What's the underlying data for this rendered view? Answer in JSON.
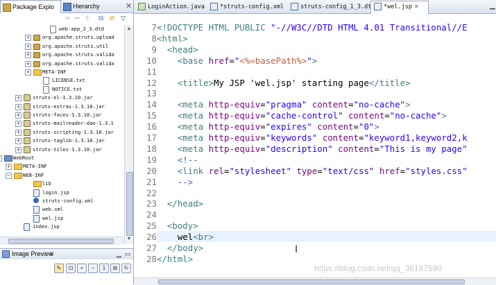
{
  "left_panel": {
    "tab_package_explorer": "Package Explo",
    "tab_hierarchy": "Hierarchy",
    "tree": [
      {
        "label": "web-app_2_3.dtd",
        "icon": "dtd-file-icon",
        "indent": 72,
        "expander": ""
      },
      {
        "label": "org.apache.struts.upload",
        "icon": "package-icon",
        "indent": 48,
        "expander": "+"
      },
      {
        "label": "org.apache.struts.util",
        "icon": "package-icon",
        "indent": 48,
        "expander": "+"
      },
      {
        "label": "org.apache.struts.valida",
        "icon": "package-icon",
        "indent": 48,
        "expander": "+"
      },
      {
        "label": "org.apache.struts.valida",
        "icon": "package-icon",
        "indent": 48,
        "expander": "+"
      },
      {
        "label": "META-INF",
        "icon": "folder-icon",
        "indent": 48,
        "expander": "+"
      },
      {
        "label": "LICENSE.txt",
        "icon": "text-file-icon",
        "indent": 62,
        "expander": ""
      },
      {
        "label": "NOTICE.txt",
        "icon": "text-file-icon",
        "indent": 62,
        "expander": ""
      },
      {
        "label": "struts-el-1.3.10.jar",
        "icon": "jar-icon",
        "indent": 34,
        "expander": "+"
      },
      {
        "label": "struts-extras-1.3.10.jar",
        "icon": "jar-icon",
        "indent": 34,
        "expander": "+"
      },
      {
        "label": "struts-faces-1.3.10.jar",
        "icon": "jar-icon",
        "indent": 34,
        "expander": "+"
      },
      {
        "label": "struts-mailreader-dao-1.3.1",
        "icon": "jar-icon",
        "indent": 34,
        "expander": "+"
      },
      {
        "label": "struts-scripting-1.3.10.jar",
        "icon": "jar-icon",
        "indent": 34,
        "expander": "+"
      },
      {
        "label": "struts-taglib-1.3.10.jar",
        "icon": "jar-icon",
        "indent": 34,
        "expander": "+"
      },
      {
        "label": "struts-tiles-1.3.10.jar",
        "icon": "jar-icon",
        "indent": 34,
        "expander": "+"
      },
      {
        "label": "WebRoot",
        "icon": "webroot-folder-icon",
        "indent": 6,
        "expander": "-"
      },
      {
        "label": "META-INF",
        "icon": "folder-icon",
        "indent": 20,
        "expander": "+"
      },
      {
        "label": "WEB-INF",
        "icon": "folder-icon",
        "indent": 20,
        "expander": "-"
      },
      {
        "label": "lib",
        "icon": "folder-icon",
        "indent": 48,
        "expander": ""
      },
      {
        "label": "login.jsp",
        "icon": "jsp-file-icon",
        "indent": 48,
        "expander": ""
      },
      {
        "label": "struts-config.xml",
        "icon": "gear-icon",
        "indent": 48,
        "expander": ""
      },
      {
        "label": "web.xml",
        "icon": "xml-file-icon",
        "indent": 48,
        "expander": ""
      },
      {
        "label": "wel.jsp",
        "icon": "jsp-file-icon",
        "indent": 48,
        "expander": ""
      },
      {
        "label": "index.jsp",
        "icon": "jsp-file-icon",
        "indent": 34,
        "expander": ""
      }
    ],
    "image_preview_tab": "Image Preview"
  },
  "editor": {
    "tabs": [
      {
        "label": "LoginAction.java",
        "active": false
      },
      {
        "label": "*struts-config.xml",
        "active": false
      },
      {
        "label": "struts-config_1_3.dt",
        "active": false
      },
      {
        "label": "*wel.jsp",
        "active": true
      }
    ],
    "lines": [
      {
        "num": "7",
        "parts": [
          [
            "doct",
            "<!DOCTYPE HTML PUBLIC "
          ],
          [
            "val",
            "\"-//W3C//DTD HTML 4.01 Transitional//E"
          ]
        ]
      },
      {
        "num": "8",
        "parts": [
          [
            "tag",
            "<html>"
          ]
        ]
      },
      {
        "num": "9",
        "parts": [
          [
            "txt",
            "  "
          ],
          [
            "tag",
            "<head>"
          ]
        ]
      },
      {
        "num": "10",
        "parts": [
          [
            "txt",
            "    "
          ],
          [
            "tag",
            "<base "
          ],
          [
            "attr",
            "href"
          ],
          [
            "txt",
            "="
          ],
          [
            "val",
            "\""
          ],
          [
            "jsp",
            "<%=basePath%>"
          ],
          [
            "val",
            "\""
          ],
          [
            "tag",
            ">"
          ]
        ]
      },
      {
        "num": "11",
        "parts": [
          [
            "txt",
            ""
          ]
        ]
      },
      {
        "num": "12",
        "parts": [
          [
            "txt",
            "    "
          ],
          [
            "tag",
            "<title>"
          ],
          [
            "txt",
            "My JSP 'wel.jsp' starting page"
          ],
          [
            "tag",
            "</title>"
          ]
        ]
      },
      {
        "num": "13",
        "parts": [
          [
            "txt",
            ""
          ]
        ]
      },
      {
        "num": "14",
        "parts": [
          [
            "txt",
            "    "
          ],
          [
            "tag",
            "<meta "
          ],
          [
            "attr",
            "http-equiv"
          ],
          [
            "txt",
            "="
          ],
          [
            "val",
            "\"pragma\""
          ],
          [
            "txt",
            " "
          ],
          [
            "attr",
            "content"
          ],
          [
            "txt",
            "="
          ],
          [
            "val",
            "\"no-cache\""
          ],
          [
            "tag",
            ">"
          ]
        ]
      },
      {
        "num": "15",
        "parts": [
          [
            "txt",
            "    "
          ],
          [
            "tag",
            "<meta "
          ],
          [
            "attr",
            "http-equiv"
          ],
          [
            "txt",
            "="
          ],
          [
            "val",
            "\"cache-control\""
          ],
          [
            "txt",
            " "
          ],
          [
            "attr",
            "content"
          ],
          [
            "txt",
            "="
          ],
          [
            "val",
            "\"no-cache\""
          ],
          [
            "tag",
            ">"
          ]
        ]
      },
      {
        "num": "16",
        "parts": [
          [
            "txt",
            "    "
          ],
          [
            "tag",
            "<meta "
          ],
          [
            "attr",
            "http-equiv"
          ],
          [
            "txt",
            "="
          ],
          [
            "val",
            "\"expires\""
          ],
          [
            "txt",
            " "
          ],
          [
            "attr",
            "content"
          ],
          [
            "txt",
            "="
          ],
          [
            "val",
            "\"0\""
          ],
          [
            "tag",
            ">"
          ]
        ]
      },
      {
        "num": "17",
        "parts": [
          [
            "txt",
            "    "
          ],
          [
            "tag",
            "<meta "
          ],
          [
            "attr",
            "http-equiv"
          ],
          [
            "txt",
            "="
          ],
          [
            "val",
            "\"keywords\""
          ],
          [
            "txt",
            " "
          ],
          [
            "attr",
            "content"
          ],
          [
            "txt",
            "="
          ],
          [
            "val",
            "\"keyword1,keyword2,k"
          ]
        ]
      },
      {
        "num": "18",
        "parts": [
          [
            "txt",
            "    "
          ],
          [
            "tag",
            "<meta "
          ],
          [
            "attr",
            "http-equiv"
          ],
          [
            "txt",
            "="
          ],
          [
            "val",
            "\"description\""
          ],
          [
            "txt",
            " "
          ],
          [
            "attr",
            "content"
          ],
          [
            "txt",
            "="
          ],
          [
            "val",
            "\"This is my page\""
          ]
        ]
      },
      {
        "num": "19",
        "parts": [
          [
            "txt",
            "    "
          ],
          [
            "cmt",
            "<!--"
          ]
        ]
      },
      {
        "num": "20",
        "parts": [
          [
            "txt",
            "    "
          ],
          [
            "tag",
            "<link "
          ],
          [
            "attr",
            "rel"
          ],
          [
            "txt",
            "="
          ],
          [
            "val",
            "\"stylesheet\""
          ],
          [
            "txt",
            " "
          ],
          [
            "attr",
            "type"
          ],
          [
            "txt",
            "="
          ],
          [
            "val",
            "\"text/css\""
          ],
          [
            "txt",
            " "
          ],
          [
            "attr",
            "href"
          ],
          [
            "txt",
            "="
          ],
          [
            "val",
            "\"styles.css\""
          ]
        ]
      },
      {
        "num": "21",
        "parts": [
          [
            "txt",
            "    "
          ],
          [
            "cmt",
            "-->"
          ]
        ]
      },
      {
        "num": "22",
        "parts": [
          [
            "txt",
            ""
          ]
        ]
      },
      {
        "num": "23",
        "parts": [
          [
            "txt",
            "  "
          ],
          [
            "tag",
            "</head>"
          ]
        ]
      },
      {
        "num": "24",
        "parts": [
          [
            "txt",
            ""
          ]
        ]
      },
      {
        "num": "25",
        "parts": [
          [
            "txt",
            "  "
          ],
          [
            "tag",
            "<body>"
          ]
        ]
      },
      {
        "num": "26",
        "parts": [
          [
            "txt",
            "    wel"
          ],
          [
            "tag",
            "<br>"
          ]
        ]
      },
      {
        "num": "27",
        "parts": [
          [
            "txt",
            "  "
          ],
          [
            "tag",
            "</body>"
          ]
        ]
      },
      {
        "num": "28",
        "parts": [
          [
            "tag",
            "</html>"
          ]
        ]
      }
    ],
    "current_line": "26",
    "watermark": "https://blog.csdn.net/qq_36187590"
  }
}
